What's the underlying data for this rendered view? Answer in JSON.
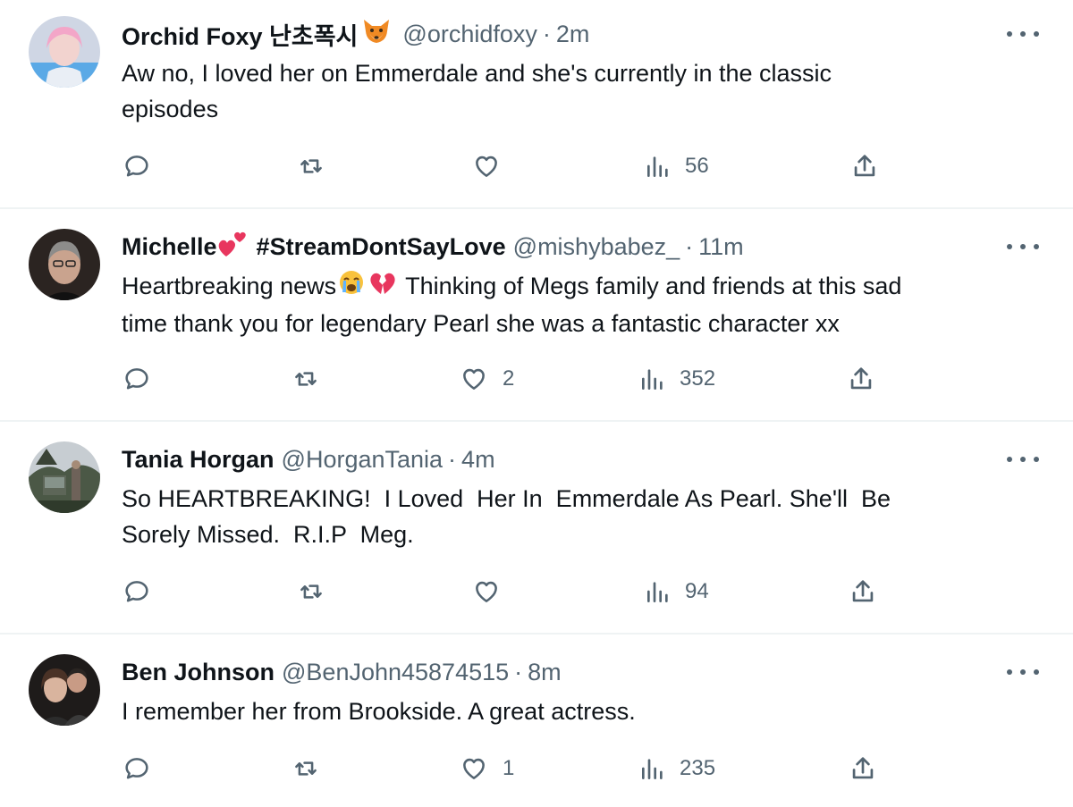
{
  "tweets": [
    {
      "name": "Orchid Foxy 난초폭시",
      "name_emoji": "fox-face",
      "handle": "@orchidfoxy",
      "separator": "·",
      "time": "2m",
      "text": "Aw no, I loved her on Emmerdale and she's currently in the classic\nepisodes",
      "replies": "",
      "reposts": "",
      "likes": "",
      "views": "56"
    },
    {
      "name": "Michelle",
      "name_emoji": "two-hearts",
      "name_suffix": "#StreamDontSayLove",
      "handle": "@mishybabez_",
      "separator": "·",
      "time": "11m",
      "text_part1": "Heartbreaking news",
      "text_emojis": [
        "loudly-crying-face",
        "broken-heart"
      ],
      "text_part2": " Thinking of Megs family and friends at this sad\ntime thank you for legendary Pearl she was a fantastic character xx",
      "replies": "",
      "reposts": "",
      "likes": "2",
      "views": "352"
    },
    {
      "name": "Tania Horgan",
      "handle": "@HorganTania",
      "separator": "·",
      "time": "4m",
      "text": "So HEARTBREAKING!  I Loved  Her In  Emmerdale As Pearl. She'll  Be\nSorely Missed.  R.I.P  Meg.",
      "replies": "",
      "reposts": "",
      "likes": "",
      "views": "94"
    },
    {
      "name": "Ben Johnson",
      "handle": "@BenJohn45874515",
      "separator": "·",
      "time": "8m",
      "text": "I remember her from Brookside. A great actress.",
      "replies": "",
      "reposts": "",
      "likes": "1",
      "views": "235"
    }
  ],
  "colors": {
    "text_primary": "#0f1419",
    "text_secondary": "#536471",
    "divider": "#eff3f4"
  },
  "icons": [
    "reply-icon",
    "repost-icon",
    "like-icon",
    "views-icon",
    "share-icon",
    "more-icon"
  ]
}
